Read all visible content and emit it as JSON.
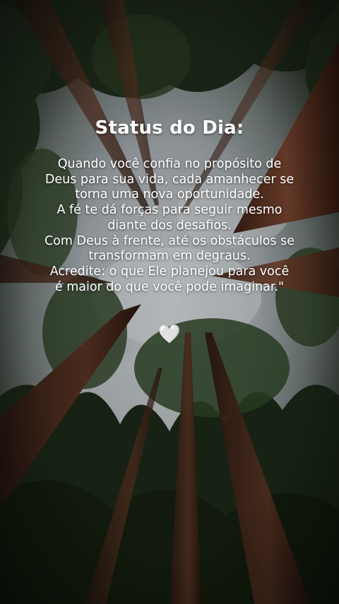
{
  "title": "Status do Dia:",
  "message_lines": [
    "Quando você confia no propósito de",
    "Deus para sua vida, cada amanhecer se",
    "torna uma nova oportunidade.",
    "A fé te dá forças para seguir mesmo",
    "diante dos desafios.",
    "Com Deus à frente, até os obstáculos se",
    "transformam em degraus.",
    "Acredite: o que Ele planejou para você",
    "é maior do que você pode imaginar.\""
  ],
  "heart_glyph": "🤍",
  "icons": {
    "heart": "white-heart-icon"
  },
  "colors": {
    "text": "#ffffff",
    "sky": "#c9ced3",
    "foliage": "#2b3a24",
    "trunk": "#5a3424"
  }
}
